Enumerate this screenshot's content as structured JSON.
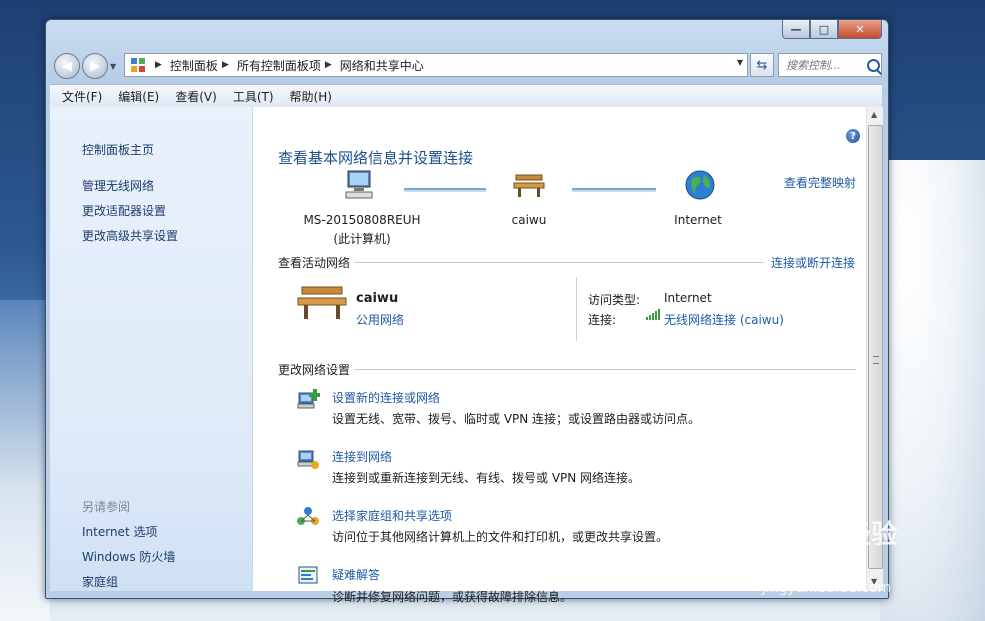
{
  "window": {
    "caption_min": "—",
    "caption_max": "□",
    "caption_close": "✕"
  },
  "nav": {
    "breadcrumbs": [
      "控制面板",
      "所有控制面板项",
      "网络和共享中心"
    ],
    "search_placeholder": "搜索控制...",
    "back_glyph": "◀",
    "forward_glyph": "▶",
    "refresh_glyph": "⇆"
  },
  "menu": [
    "文件(F)",
    "编辑(E)",
    "查看(V)",
    "工具(T)",
    "帮助(H)"
  ],
  "sidebar": {
    "home": "控制面板主页",
    "links": [
      "管理无线网络",
      "更改适配器设置",
      "更改高级共享设置"
    ],
    "see_also_title": "另请参阅",
    "see_also": [
      "Internet 选项",
      "Windows 防火墙",
      "家庭组"
    ]
  },
  "main": {
    "title": "查看基本网络信息并设置连接",
    "full_map_link": "查看完整映射",
    "nodes": [
      {
        "label": "MS-20150808REUH",
        "sub": "(此计算机)",
        "icon": "computer-icon"
      },
      {
        "label": "caiwu",
        "sub": "",
        "icon": "bench-icon"
      },
      {
        "label": "Internet",
        "sub": "",
        "icon": "globe-icon"
      }
    ],
    "active_section": "查看活动网络",
    "connect_link": "连接或断开连接",
    "active_network": {
      "name": "caiwu",
      "type": "公用网络",
      "access_label": "访问类型:",
      "access_value": "Internet",
      "conn_label": "连接:",
      "conn_value": "无线网络连接 (caiwu)"
    },
    "change_section": "更改网络设置",
    "tasks": [
      {
        "title": "设置新的连接或网络",
        "desc": "设置无线、宽带、拨号、临时或 VPN 连接；或设置路由器或访问点。",
        "icon": "new-connection-icon"
      },
      {
        "title": "连接到网络",
        "desc": "连接到或重新连接到无线、有线、拨号或 VPN 网络连接。",
        "icon": "connect-network-icon"
      },
      {
        "title": "选择家庭组和共享选项",
        "desc": "访问位于其他网络计算机上的文件和打印机，或更改共享设置。",
        "icon": "homegroup-icon"
      },
      {
        "title": "疑难解答",
        "desc": "诊断并修复网络问题，或获得故障排除信息。",
        "icon": "troubleshoot-icon"
      }
    ]
  },
  "help_glyph": "?",
  "watermark": {
    "main": "Baidu经验",
    "sub": "jingyan.baidu.com"
  }
}
